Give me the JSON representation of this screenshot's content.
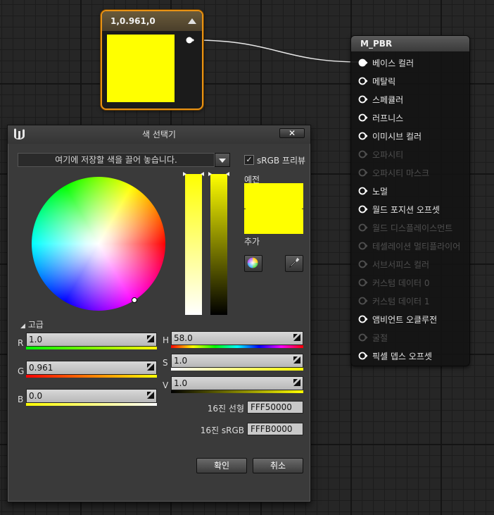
{
  "constant_node": {
    "title": "1,0.961,0",
    "color": "#ffff00"
  },
  "material_node": {
    "title": "M_PBR",
    "pins": [
      {
        "label": "베이스 컬러",
        "enabled": true,
        "connected": true
      },
      {
        "label": "메탈릭",
        "enabled": true,
        "connected": false
      },
      {
        "label": "스페큘러",
        "enabled": true,
        "connected": false
      },
      {
        "label": "러프니스",
        "enabled": true,
        "connected": false
      },
      {
        "label": "이미시브 컬러",
        "enabled": true,
        "connected": false
      },
      {
        "label": "오파시티",
        "enabled": false,
        "connected": false
      },
      {
        "label": "오파시티 마스크",
        "enabled": false,
        "connected": false
      },
      {
        "label": "노멀",
        "enabled": true,
        "connected": false
      },
      {
        "label": "월드 포지션 오프셋",
        "enabled": true,
        "connected": false
      },
      {
        "label": "월드 디스플레이스먼트",
        "enabled": false,
        "connected": false
      },
      {
        "label": "테셀레이션 멀티플라이어",
        "enabled": false,
        "connected": false
      },
      {
        "label": "서브서피스 컬러",
        "enabled": false,
        "connected": false
      },
      {
        "label": "커스텀 데이터 0",
        "enabled": false,
        "connected": false
      },
      {
        "label": "커스텀 데이터 1",
        "enabled": false,
        "connected": false
      },
      {
        "label": "앰비언트 오클루전",
        "enabled": true,
        "connected": false
      },
      {
        "label": "굴절",
        "enabled": false,
        "connected": false
      },
      {
        "label": "픽셀 뎁스 오프셋",
        "enabled": true,
        "connected": false
      }
    ]
  },
  "color_picker": {
    "title": "색 선택기",
    "close_label": "✕",
    "drop_hint": "여기에 저장할 색을 끌어 놓습니다.",
    "srgb_preview_label": "sRGB 프리뷰",
    "srgb_checked": "✓",
    "old_label": "예전",
    "new_label": "추가",
    "advanced_label": "고급",
    "r_label": "R",
    "r_value": "1.0",
    "g_label": "G",
    "g_value": "0.961",
    "b_label": "B",
    "b_value": "0.0",
    "h_label": "H",
    "h_value": "58.0",
    "s_label": "S",
    "s_value": "1.0",
    "v_label": "V",
    "v_value": "1.0",
    "hex_linear_label": "16진 선형",
    "hex_linear_value": "FFF50000",
    "hex_srgb_label": "16진 sRGB",
    "hex_srgb_value": "FFFB0000",
    "ok_label": "확인",
    "cancel_label": "취소",
    "current_color": "#ffff00"
  }
}
